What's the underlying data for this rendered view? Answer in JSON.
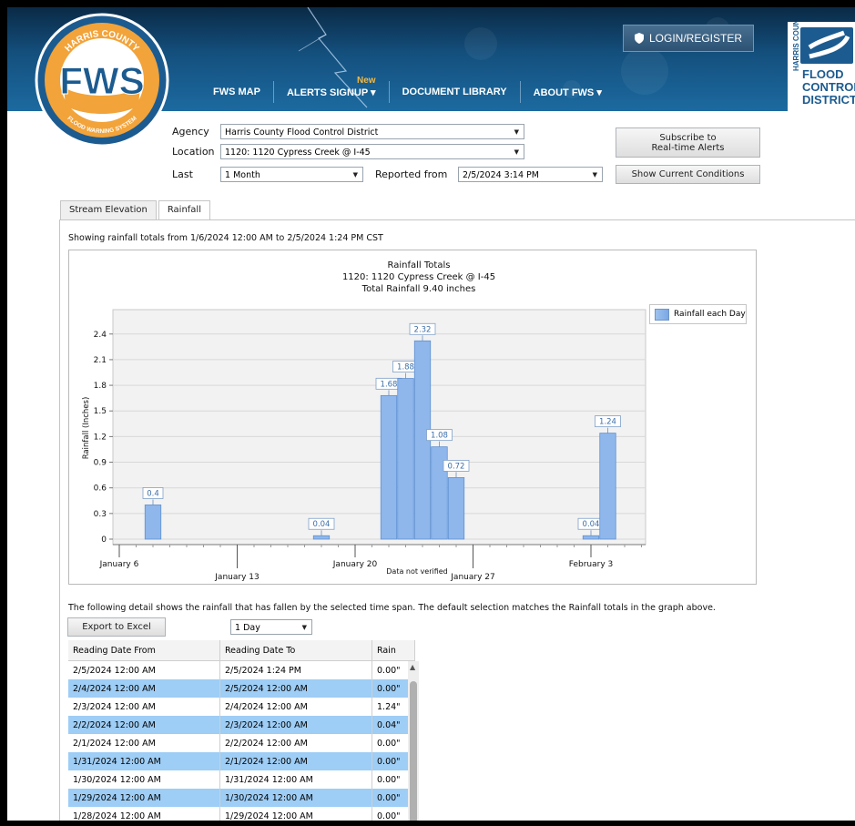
{
  "header": {
    "logo_ring_top": "HARRIS COUNTY",
    "logo_letters": "FWS",
    "logo_ring_bottom": "FLOOD WARNING SYSTEM",
    "nav": [
      {
        "label": "FWS MAP"
      },
      {
        "label": "ALERTS SIGNUP ▾",
        "badge": "New"
      },
      {
        "label": "DOCUMENT LIBRARY"
      },
      {
        "label": "ABOUT FWS ▾"
      }
    ],
    "login_label": "LOGIN/REGISTER",
    "district_logo": {
      "vertical": "HARRIS COUNTY",
      "line1": "FLOOD",
      "line2": "CONTROL",
      "line3": "DISTRICT"
    }
  },
  "filters": {
    "agency_label": "Agency",
    "agency_value": "Harris County Flood Control District",
    "location_label": "Location",
    "location_value": "1120: 1120 Cypress Creek @ I-45",
    "last_label": "Last",
    "last_value": "1 Month",
    "reported_label": "Reported from",
    "reported_value": "2/5/2024 3:14 PM",
    "subscribe_label": "Subscribe to Real-time Alerts",
    "subscribe_line1": "Subscribe to",
    "subscribe_line2": "Real-time Alerts",
    "current_label": "Show Current Conditions"
  },
  "tabs": [
    {
      "label": "Stream Elevation"
    },
    {
      "label": "Rainfall",
      "active": true
    }
  ],
  "summary_text": "Showing rainfall totals from 1/6/2024 12:00 AM to 2/5/2024 1:24 PM CST",
  "chart_data": {
    "type": "bar",
    "title": "Rainfall Totals",
    "subtitle1": "1120: 1120 Cypress Creek @ I-45",
    "subtitle2": "Total Rainfall 9.40 inches",
    "ylabel": "Rainfall (Inches)",
    "ylim": [
      0,
      2.6
    ],
    "yticks": [
      "0",
      "0.3",
      "0.6",
      "0.9",
      "1.2",
      "1.5",
      "1.8",
      "2.1",
      "2.4"
    ],
    "xticks": [
      {
        "label": "January 6",
        "day": 0,
        "row": 1
      },
      {
        "label": "January 13",
        "day": 7,
        "row": 2
      },
      {
        "label": "January 20",
        "day": 14,
        "row": 1
      },
      {
        "label": "January 27",
        "day": 21,
        "row": 2
      },
      {
        "label": "February 3",
        "day": 28,
        "row": 1
      }
    ],
    "series": [
      {
        "name": "Rainfall each Day",
        "points": [
          {
            "day": 2,
            "value": 0.4,
            "label": "0.4"
          },
          {
            "day": 12,
            "value": 0.04,
            "label": "0.04"
          },
          {
            "day": 16,
            "value": 1.68,
            "label": "1.68"
          },
          {
            "day": 17,
            "value": 1.88,
            "label": "1.88"
          },
          {
            "day": 18,
            "value": 2.32,
            "label": "2.32"
          },
          {
            "day": 19,
            "value": 1.08,
            "label": "1.08"
          },
          {
            "day": 20,
            "value": 0.72,
            "label": "0.72"
          },
          {
            "day": 28,
            "value": 0.04,
            "label": "0.04"
          },
          {
            "day": 29,
            "value": 1.24,
            "label": "1.24"
          }
        ]
      }
    ],
    "legend": "top-right",
    "footnote": "Data not verified"
  },
  "detail_text": "The following detail shows the rainfall that has fallen by the selected time span. The default selection matches the Rainfall totals in the graph above.",
  "export_label": "Export to Excel",
  "timespan_value": "1 Day",
  "table": {
    "headers": [
      "Reading Date From",
      "Reading Date To",
      "Rain"
    ],
    "rows": [
      [
        "2/5/2024 12:00 AM",
        "2/5/2024 1:24 PM",
        "0.00\""
      ],
      [
        "2/4/2024 12:00 AM",
        "2/5/2024 12:00 AM",
        "0.00\""
      ],
      [
        "2/3/2024 12:00 AM",
        "2/4/2024 12:00 AM",
        "1.24\""
      ],
      [
        "2/2/2024 12:00 AM",
        "2/3/2024 12:00 AM",
        "0.04\""
      ],
      [
        "2/1/2024 12:00 AM",
        "2/2/2024 12:00 AM",
        "0.00\""
      ],
      [
        "1/31/2024 12:00 AM",
        "2/1/2024 12:00 AM",
        "0.00\""
      ],
      [
        "1/30/2024 12:00 AM",
        "1/31/2024 12:00 AM",
        "0.00\""
      ],
      [
        "1/29/2024 12:00 AM",
        "1/30/2024 12:00 AM",
        "0.00\""
      ],
      [
        "1/28/2024 12:00 AM",
        "1/29/2024 12:00 AM",
        "0.00\""
      ]
    ]
  },
  "colors": {
    "bar": "#8fb7ec",
    "row_highlight": "#9ecdf5",
    "header_blue": "#14507e",
    "logo_orange": "#f2a33a"
  }
}
